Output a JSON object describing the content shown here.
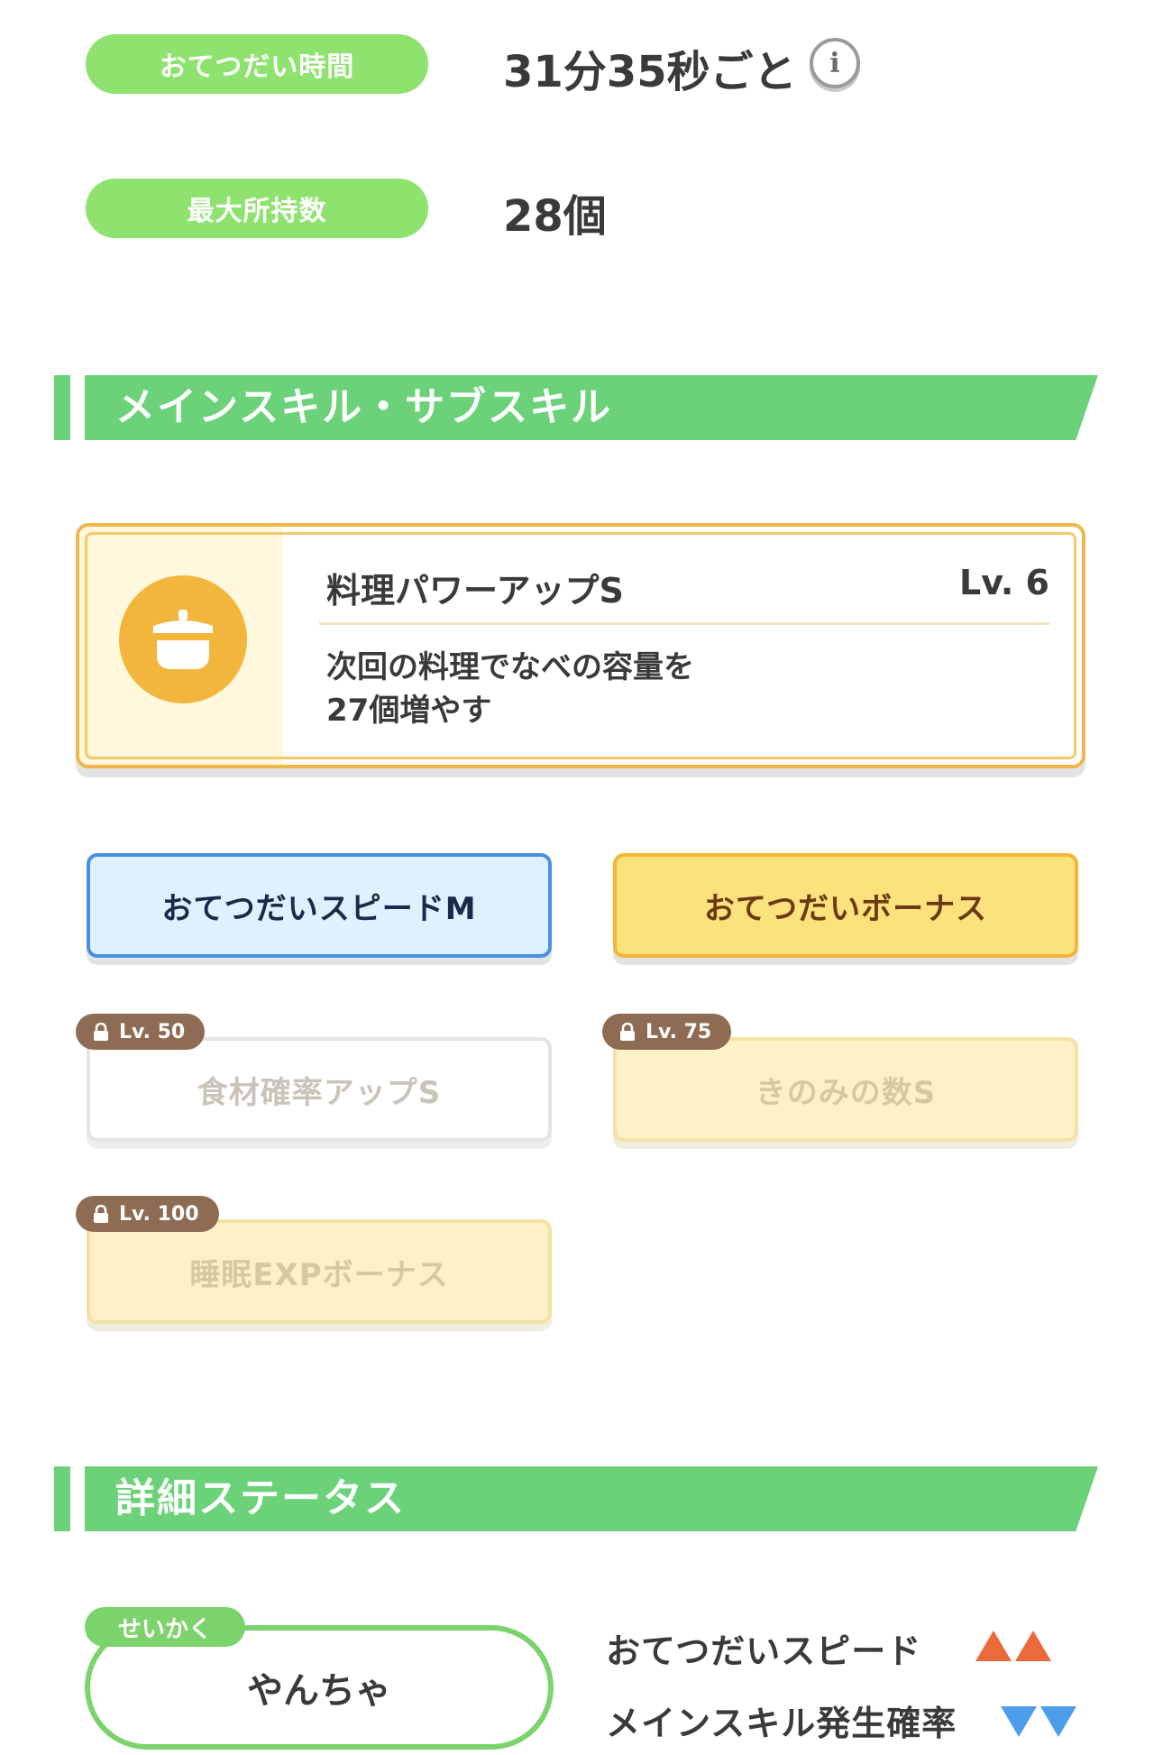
{
  "stats": {
    "help_time_label": "おてつだい時間",
    "help_time_value": "31分35秒ごと",
    "max_carry_label": "最大所持数",
    "max_carry_value": "28個"
  },
  "skills_section": {
    "title": "メインスキル・サブスキル",
    "main_skill": {
      "name": "料理パワーアップS",
      "level": "Lv. 6",
      "description_line1": "次回の料理でなべの容量を",
      "description_line2": "27個増やす",
      "icon": "cooking-pot-icon"
    },
    "sub_skills": [
      {
        "label": "おてつだいスピードM",
        "unlocked": true
      },
      {
        "label": "おてつだいボーナス",
        "unlocked": true
      },
      {
        "label": "食材確率アップS",
        "unlocked": false,
        "lock_level": "Lv. 50"
      },
      {
        "label": "きのみの数S",
        "unlocked": false,
        "lock_level": "Lv. 75"
      },
      {
        "label": "睡眠EXPボーナス",
        "unlocked": false,
        "lock_level": "Lv. 100"
      }
    ]
  },
  "detail_section": {
    "title": "詳細ステータス",
    "nature_tag": "せいかく",
    "nature_value": "やんちゃ",
    "effects": [
      {
        "label": "おてつだいスピード",
        "direction": "up",
        "count": 2,
        "color": "#ea6a3c"
      },
      {
        "label": "メインスキル発生確率",
        "direction": "down",
        "count": 2,
        "color": "#4d9eea"
      }
    ]
  },
  "colors": {
    "accent_green": "#6bd27a",
    "pill_green": "#8ee26e",
    "skill_orange": "#f3b63c",
    "lock_brown": "#8e6c53"
  }
}
